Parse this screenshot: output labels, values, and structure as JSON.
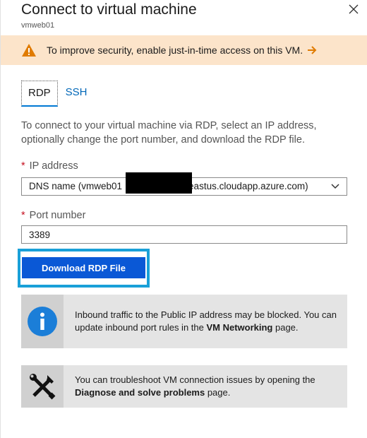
{
  "header": {
    "title": "Connect to virtual machine",
    "subtitle": "vmweb01",
    "close_icon": "close-icon"
  },
  "banner": {
    "message": "To improve security, enable just-in-time access on this VM.",
    "icon": "warning-icon",
    "arrow_icon": "arrow-right-icon",
    "background_color": "#fce4ca",
    "accent_color": "#e07b00"
  },
  "tabs": [
    {
      "label": "RDP",
      "active": true
    },
    {
      "label": "SSH",
      "active": false
    }
  ],
  "description": "To connect to your virtual machine via RDP, select an IP address, optionally change the port number, and download the RDP file.",
  "ip_address": {
    "label": "IP address",
    "required_marker": "*",
    "selected_prefix": "DNS name (vmweb01",
    "selected_suffix": "eastus.cloudapp.azure.com)"
  },
  "port": {
    "label": "Port number",
    "required_marker": "*",
    "value": "3389"
  },
  "download_button": {
    "label": "Download RDP File",
    "color": "#0a58d6",
    "highlight_color": "#19a0d8"
  },
  "info_network": {
    "icon": "info-icon",
    "text_before": "Inbound traffic to the Public IP address may be blocked. You can update inbound port rules in the ",
    "link_text": "VM Networking",
    "text_after": " page."
  },
  "info_troubleshoot": {
    "icon": "tools-icon",
    "text_before": "You can troubleshoot VM connection issues by opening the ",
    "link_text": "Diagnose and solve problems",
    "text_after": " page."
  }
}
